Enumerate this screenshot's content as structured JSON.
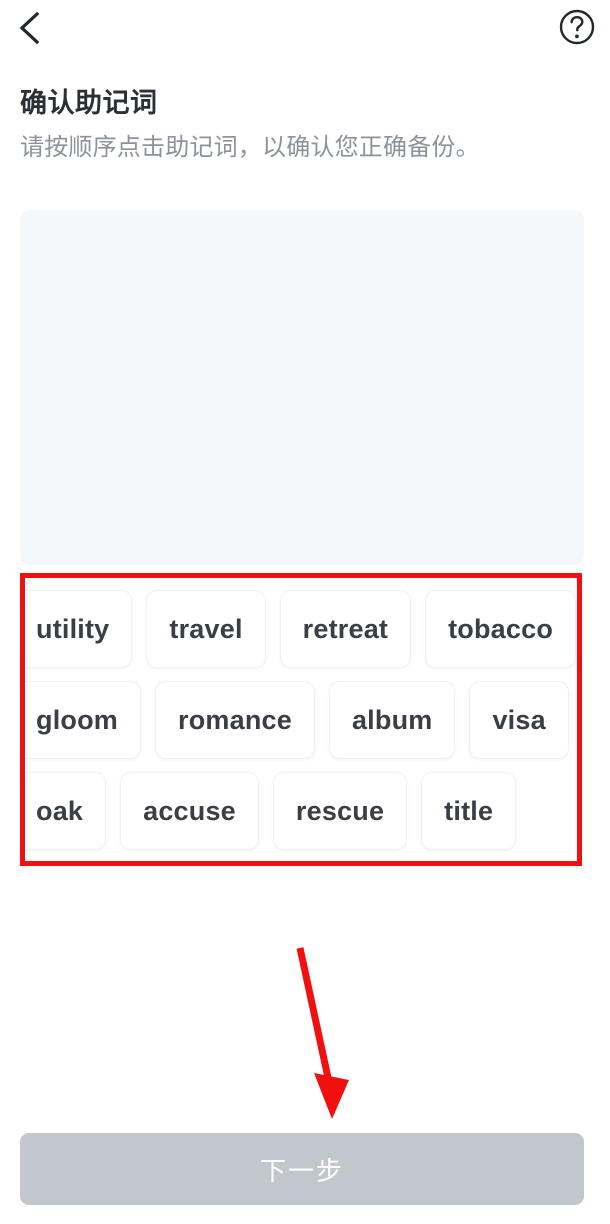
{
  "header": {
    "back_icon": "chevron-left-icon",
    "help_icon": "question-mark-circle-icon"
  },
  "page": {
    "title": "确认助记词",
    "subtitle": "请按顺序点击助记词，以确认您正确备份。"
  },
  "selection_panel": {
    "selected_words": []
  },
  "word_bank": {
    "rows": [
      [
        "utility",
        "travel",
        "retreat",
        "tobacco"
      ],
      [
        "gloom",
        "romance",
        "album",
        "visa"
      ],
      [
        "oak",
        "accuse",
        "rescue",
        "title"
      ]
    ],
    "words": [
      "utility",
      "travel",
      "retreat",
      "tobacco",
      "gloom",
      "romance",
      "album",
      "visa",
      "oak",
      "accuse",
      "rescue",
      "title"
    ]
  },
  "footer": {
    "next_label": "下一步"
  },
  "annotations": {
    "highlight_color": "#f01010",
    "arrow_color": "#f01010"
  },
  "colors": {
    "title_text": "#2b2f36",
    "subtitle_text": "#8d939c",
    "panel_bg": "#f4f8fb",
    "chip_bg": "#ffffff",
    "chip_text": "#3a3f47",
    "button_bg": "#c2c6cd",
    "button_text": "#ffffff"
  }
}
